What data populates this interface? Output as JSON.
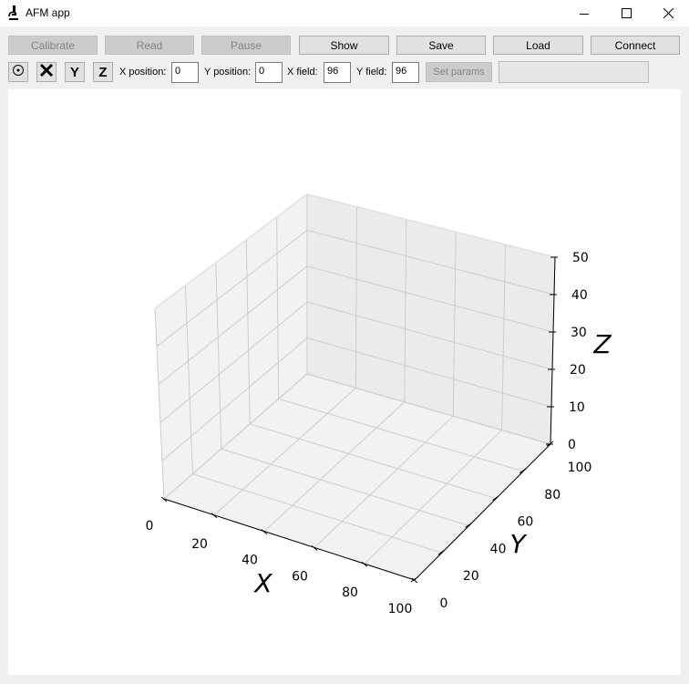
{
  "window": {
    "title": "AFM app",
    "icon": "microscope-icon",
    "controls": [
      "minimize-icon",
      "maximize-icon",
      "close-icon"
    ]
  },
  "toolbar": {
    "calibrate": "Calibrate",
    "read": "Read",
    "pause": "Pause",
    "show": "Show",
    "save": "Save",
    "load": "Load",
    "connect": "Connect"
  },
  "tools": {
    "target": "target-icon",
    "x_label": "X",
    "y_label": "Y",
    "z_label": "Z"
  },
  "params": {
    "x_position_label": "X position:",
    "x_position_value": "0",
    "y_position_label": "Y position:",
    "y_position_value": "0",
    "x_field_label": "X field:",
    "x_field_value": "96",
    "y_field_label": "Y field:",
    "y_field_value": "96",
    "set_params": "Set params",
    "status_value": ""
  },
  "chart_data": {
    "type": "scatter",
    "projection": "3d",
    "series": [],
    "xlabel": "X",
    "ylabel": "Y",
    "zlabel": "Z",
    "xlim": [
      0,
      100
    ],
    "ylim": [
      0,
      100
    ],
    "zlim": [
      0,
      50
    ],
    "xticks": [
      "0",
      "20",
      "40",
      "60",
      "80",
      "100"
    ],
    "yticks": [
      "0",
      "20",
      "40",
      "60",
      "80",
      "100"
    ],
    "zticks": [
      "0",
      "10",
      "20",
      "30",
      "40",
      "50"
    ],
    "grid": true,
    "pane_color": "#f2f2f2",
    "grid_color": "#cccccc"
  }
}
